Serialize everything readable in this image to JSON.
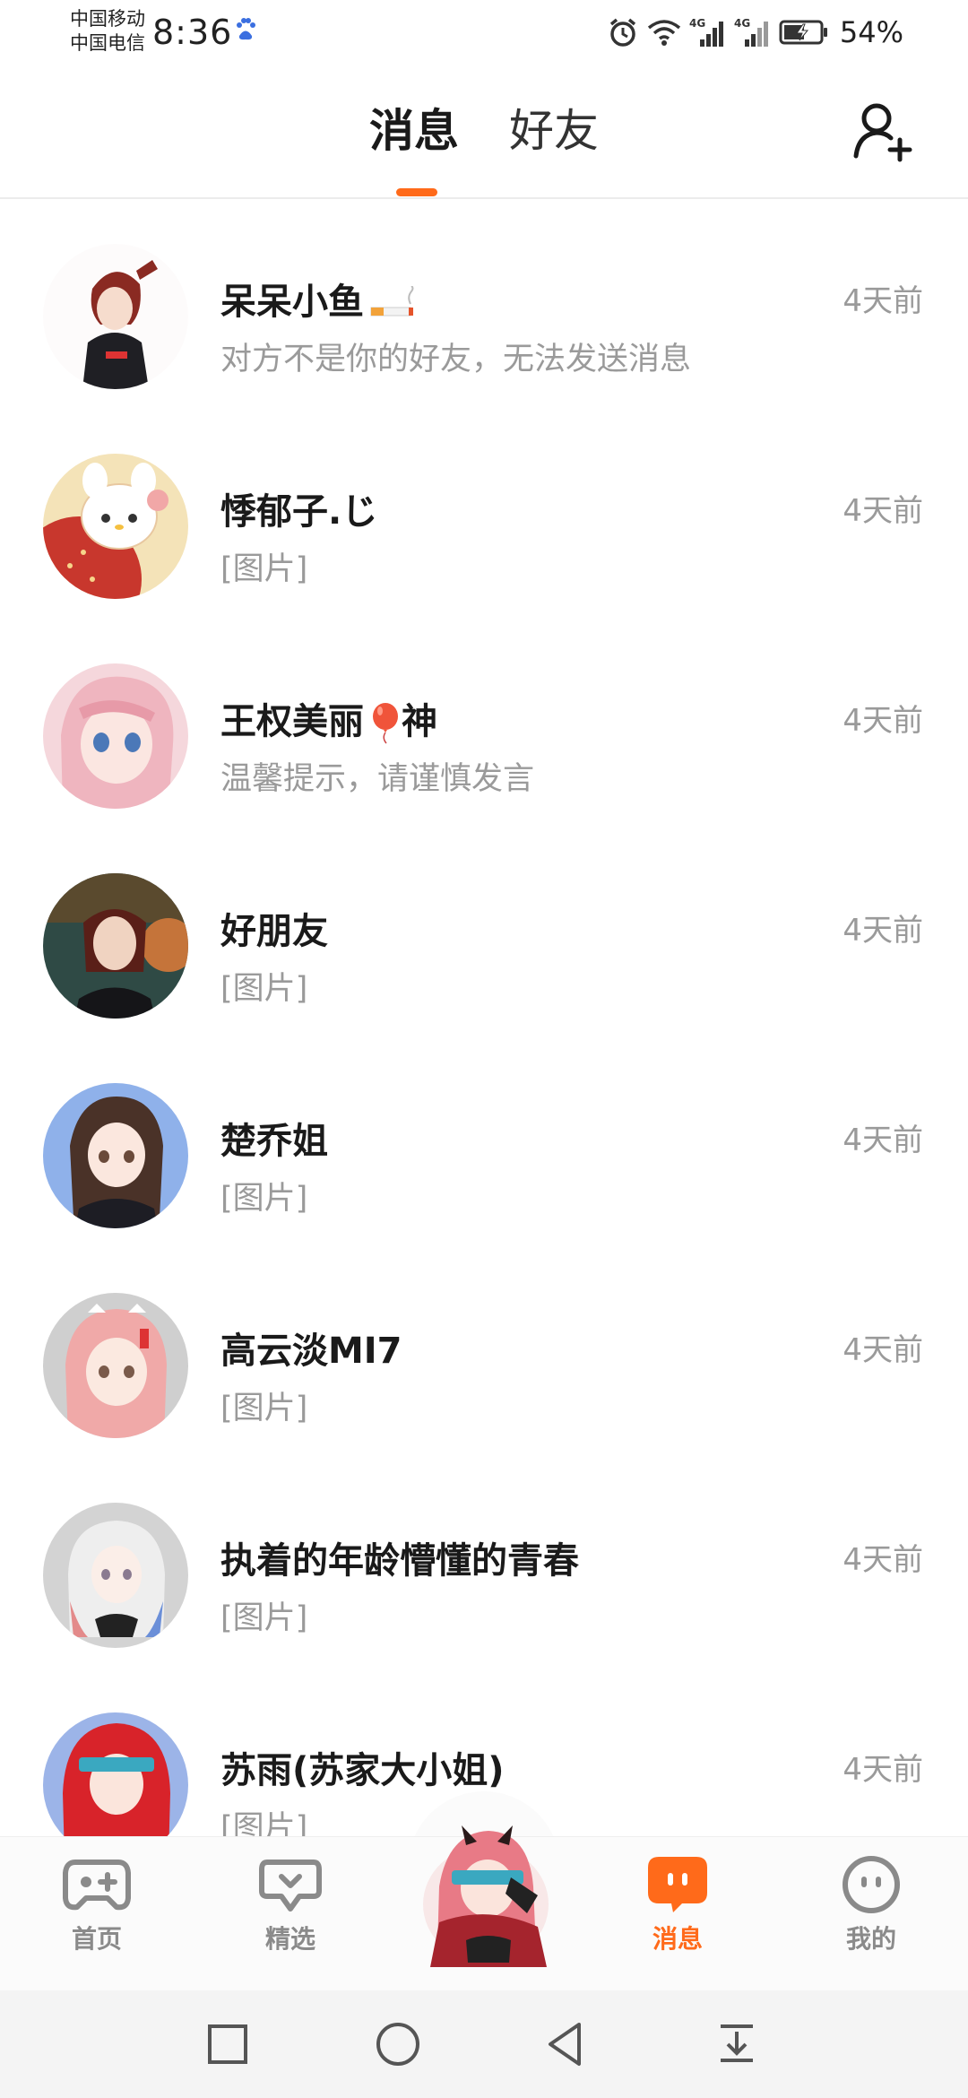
{
  "status_bar": {
    "carrier_1": "中国移动",
    "carrier_2": "中国电信",
    "time": "8:36",
    "signal_1": "4G",
    "signal_2": "4G",
    "battery": "54%"
  },
  "header": {
    "tabs": [
      {
        "label": "消息",
        "active": true
      },
      {
        "label": "好友",
        "active": false
      }
    ],
    "accent_color": "#ff6a1a"
  },
  "conversations": [
    {
      "name": "呆呆小鱼",
      "emoji": "cigarette",
      "preview": "对方不是你的好友，无法发送消息",
      "time": "4天前"
    },
    {
      "name": "悸郁子.じ",
      "preview": "[图片]",
      "time": "4天前"
    },
    {
      "name": "王权美丽",
      "emoji": "balloon",
      "name_suffix": "神",
      "preview": "温馨提示，请谨慎发言",
      "time": "4天前"
    },
    {
      "name": "好朋友",
      "preview": "[图片]",
      "time": "4天前"
    },
    {
      "name": "楚乔姐",
      "preview": "[图片]",
      "time": "4天前"
    },
    {
      "name": "高云淡MI7",
      "preview": "[图片]",
      "time": "4天前"
    },
    {
      "name": "执着的年龄懵懂的青春",
      "preview": "[图片]",
      "time": "4天前"
    },
    {
      "name": "苏雨(苏家大小姐)",
      "preview": "[图片]",
      "time": "4天前"
    }
  ],
  "bottom_nav": {
    "items": [
      {
        "label": "首页",
        "icon": "gamepad-icon",
        "active": false
      },
      {
        "label": "精选",
        "icon": "heart-chat-icon",
        "active": false
      },
      {
        "label": "消息",
        "icon": "message-bubble-icon",
        "active": true
      },
      {
        "label": "我的",
        "icon": "smiley-icon",
        "active": false
      }
    ]
  }
}
